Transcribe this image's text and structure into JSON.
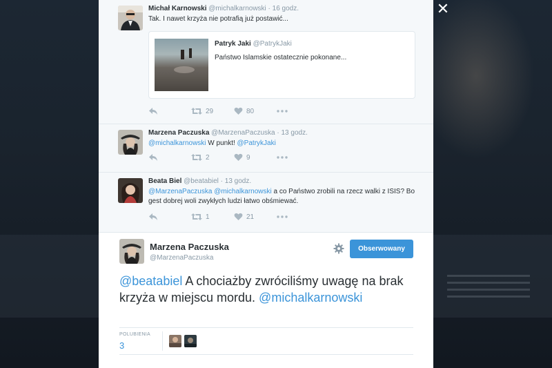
{
  "modal": {
    "close_label": "✕"
  },
  "tweets": [
    {
      "fullname": "Michał Karnowski",
      "username": "@michalkarnowski",
      "time": "· 16 godz.",
      "text": "Tak. I nawet krzyża nie potrafią już postawić...",
      "quote": {
        "fullname": "Patryk Jaki",
        "username": "@PatrykJaki",
        "text": "Państwo Islamskie ostatecznie pokonane..."
      },
      "retweets": "29",
      "likes": "80"
    },
    {
      "fullname": "Marzena Paczuska",
      "username": "@MarzenaPaczuska",
      "time": "· 13 godz.",
      "mention1": "@michalkarnowski",
      "text_mid": " W punkt! ",
      "mention2": "@PatrykJaki",
      "retweets": "2",
      "likes": "9"
    },
    {
      "fullname": "Beata Biel",
      "username": "@beatabiel",
      "time": "· 13 godz.",
      "mention1": "@MarzenaPaczuska",
      "mention2": "@michalkarnowski",
      "text_rest": " a co Państwo zrobili na rzecz walki z ISIS? Bo gest dobrej woli zwykłych ludzi łatwo obśmiewać.",
      "retweets": "1",
      "likes": "21"
    }
  ],
  "main_tweet": {
    "fullname": "Marzena Paczuska",
    "username": "@MarzenaPaczuska",
    "follow_label": "Obserwowany",
    "mention1": "@beatabiel",
    "text": " A chociażby zwróciliśmy uwagę na brak krzyża w miejscu mordu. ",
    "mention2": "@michalkarnowski",
    "likes_label": "POLUBIENIA",
    "likes_count": "3"
  },
  "colors": {
    "accent": "#3b94d9",
    "text": "#292f33",
    "muted": "#8899a6",
    "background": "#141a22"
  },
  "icons": [
    "reply-icon",
    "retweet-icon",
    "like-icon",
    "more-icon",
    "gear-icon",
    "close-icon"
  ]
}
